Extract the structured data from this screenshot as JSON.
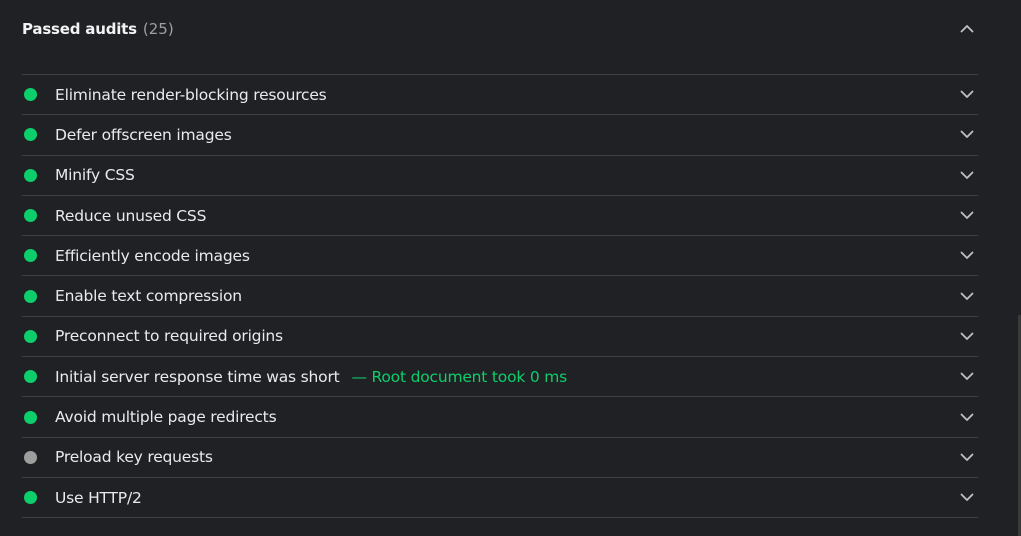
{
  "section": {
    "title": "Passed audits",
    "count": "(25)"
  },
  "colors": {
    "pass": "#0cce6b",
    "neutral": "#9e9e9e",
    "display_value": "#0cce6b",
    "chevron": "#bdc1c6"
  },
  "icons": {
    "collapse": "chevron-up-icon",
    "expand": "chevron-down-icon",
    "status": "status-dot-icon"
  },
  "audits": [
    {
      "label": "Eliminate render-blocking resources",
      "status": "pass",
      "display_value": ""
    },
    {
      "label": "Defer offscreen images",
      "status": "pass",
      "display_value": ""
    },
    {
      "label": "Minify CSS",
      "status": "pass",
      "display_value": ""
    },
    {
      "label": "Reduce unused CSS",
      "status": "pass",
      "display_value": ""
    },
    {
      "label": "Efficiently encode images",
      "status": "pass",
      "display_value": ""
    },
    {
      "label": "Enable text compression",
      "status": "pass",
      "display_value": ""
    },
    {
      "label": "Preconnect to required origins",
      "status": "pass",
      "display_value": ""
    },
    {
      "label": "Initial server response time was short",
      "status": "pass",
      "display_value": "— Root document took 0 ms"
    },
    {
      "label": "Avoid multiple page redirects",
      "status": "pass",
      "display_value": ""
    },
    {
      "label": "Preload key requests",
      "status": "neutral",
      "display_value": ""
    },
    {
      "label": "Use HTTP/2",
      "status": "pass",
      "display_value": ""
    }
  ]
}
